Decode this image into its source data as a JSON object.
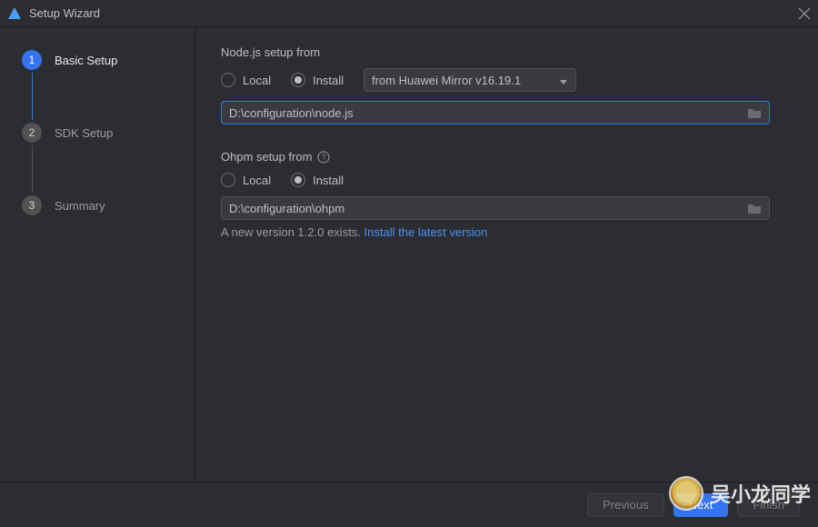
{
  "window": {
    "title": "Setup Wizard"
  },
  "sidebar": {
    "steps": [
      {
        "num": "1",
        "label": "Basic Setup"
      },
      {
        "num": "2",
        "label": "SDK Setup"
      },
      {
        "num": "3",
        "label": "Summary"
      }
    ]
  },
  "nodejs": {
    "section_label": "Node.js setup from",
    "local_label": "Local",
    "install_label": "Install",
    "mirror_selected": "from Huawei Mirror v16.19.1",
    "path": "D:\\configuration\\node.js"
  },
  "ohpm": {
    "section_label": "Ohpm setup from",
    "local_label": "Local",
    "install_label": "Install",
    "path": "D:\\configuration\\ohpm",
    "version_status_prefix": "A new version 1.2.0 exists. ",
    "install_link": "Install the latest version"
  },
  "footer": {
    "previous": "Previous",
    "next": "Next",
    "finish": "Finish"
  },
  "watermark": {
    "text": "吴小龙同学"
  }
}
